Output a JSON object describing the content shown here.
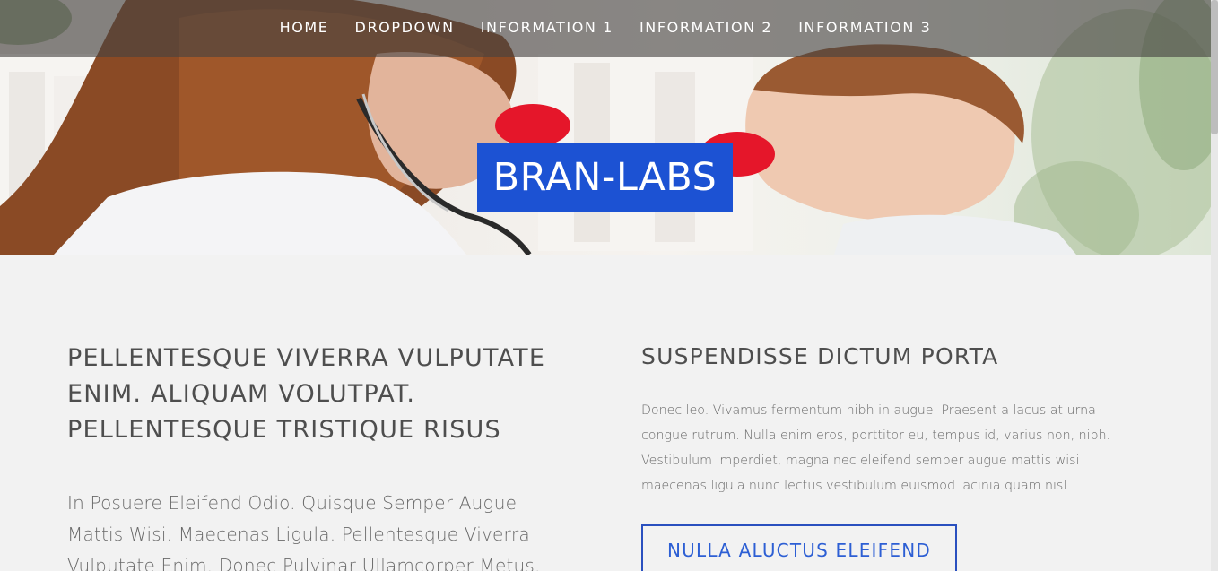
{
  "nav": {
    "items": [
      {
        "label": "HOME"
      },
      {
        "label": "DROPDOWN"
      },
      {
        "label": "INFORMATION 1"
      },
      {
        "label": "INFORMATION 2"
      },
      {
        "label": "INFORMATION 3"
      }
    ]
  },
  "hero": {
    "brand": "BRAN-LABS",
    "photo": "doctor-and-child-clown-noses-photo"
  },
  "left": {
    "heading": "PELLENTESQUE VIVERRA VULPUTATE ENIM. ALIQUAM VOLUTPAT. PELLENTESQUE TRISTIQUE RISUS",
    "body": "In Posuere Eleifend Odio. Quisque Semper Augue Mattis Wisi. Maecenas Ligula. Pellentesque Viverra Vulputate Enim. Donec Pulvinar Ullamcorper Metus."
  },
  "right": {
    "heading": "SUSPENDISSE DICTUM PORTA",
    "body": "Donec leo. Vivamus fermentum nibh in augue. Praesent a lacus at urna congue rutrum. Nulla enim eros, porttitor eu, tempus id, varius non, nibh. Vestibulum imperdiet, magna nec eleifend semper augue mattis wisi maecenas ligula nunc lectus vestibulum euismod lacinia quam nisl.",
    "button_label": "NULLA ALUCTUS ELEIFEND"
  },
  "colors": {
    "brand_blue": "#1c52d3",
    "button_border": "#2a50bf",
    "button_text": "#2d5fd4",
    "background": "#f2f2f2",
    "heading_text": "#4e4e4e"
  }
}
